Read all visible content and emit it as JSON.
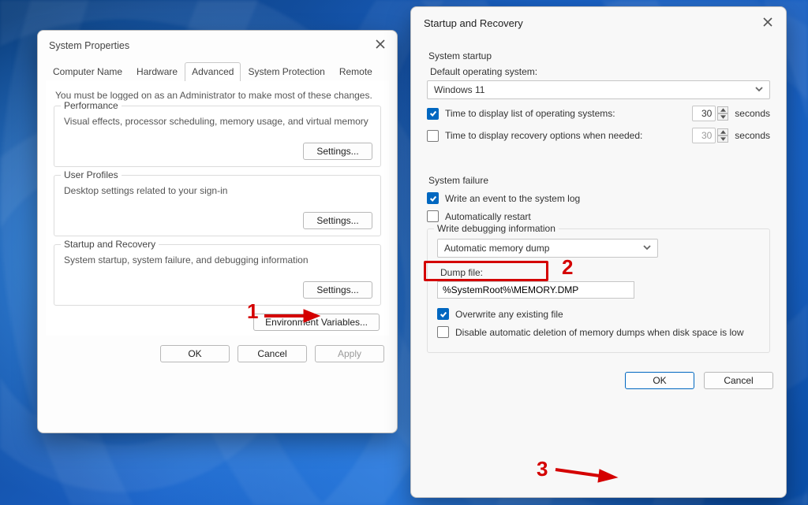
{
  "sysprop": {
    "title": "System Properties",
    "tabs": [
      "Computer Name",
      "Hardware",
      "Advanced",
      "System Protection",
      "Remote"
    ],
    "active_tab_index": 2,
    "admin_note": "You must be logged on as an Administrator to make most of these changes.",
    "groups": {
      "performance": {
        "title": "Performance",
        "desc": "Visual effects, processor scheduling, memory usage, and virtual memory",
        "button": "Settings..."
      },
      "profiles": {
        "title": "User Profiles",
        "desc": "Desktop settings related to your sign-in",
        "button": "Settings..."
      },
      "startup": {
        "title": "Startup and Recovery",
        "desc": "System startup, system failure, and debugging information",
        "button": "Settings..."
      }
    },
    "env_button": "Environment Variables...",
    "footer": {
      "ok": "OK",
      "cancel": "Cancel",
      "apply": "Apply"
    }
  },
  "startup": {
    "title": "Startup and Recovery",
    "system_startup_label": "System startup",
    "default_os_label": "Default operating system:",
    "default_os_value": "Windows 11",
    "display_os_list": {
      "checked": true,
      "label": "Time to display list of operating systems:",
      "value": "30",
      "unit": "seconds"
    },
    "display_recovery": {
      "checked": false,
      "label": "Time to display recovery options when needed:",
      "value": "30",
      "unit": "seconds"
    },
    "system_failure_label": "System failure",
    "write_event": {
      "checked": true,
      "label": "Write an event to the system log"
    },
    "auto_restart": {
      "checked": false,
      "label": "Automatically restart"
    },
    "debug_group_title": "Write debugging information",
    "dump_type": "Automatic memory dump",
    "dump_file_label": "Dump file:",
    "dump_file_value": "%SystemRoot%\\MEMORY.DMP",
    "overwrite": {
      "checked": true,
      "label": "Overwrite any existing file"
    },
    "disable_delete": {
      "checked": false,
      "label": "Disable automatic deletion of memory dumps when disk space is low"
    },
    "footer": {
      "ok": "OK",
      "cancel": "Cancel"
    }
  },
  "annotations": {
    "one": "1",
    "two": "2",
    "three": "3"
  }
}
